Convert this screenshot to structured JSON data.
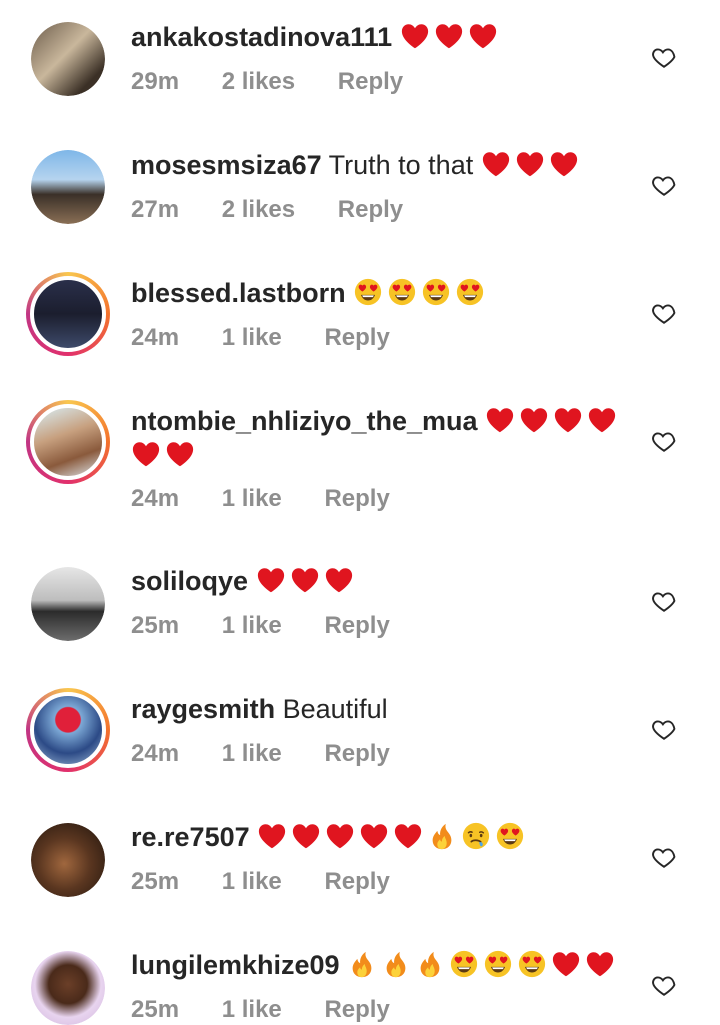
{
  "comments": [
    {
      "username": "ankakostadinova111",
      "text": "",
      "emoji": [
        "heart",
        "heart",
        "heart"
      ],
      "time": "29m",
      "likes": "2 likes",
      "reply": "Reply",
      "story": false
    },
    {
      "username": "mosesmsiza67",
      "text": "Truth to that",
      "emoji": [
        "heart",
        "heart",
        "heart"
      ],
      "time": "27m",
      "likes": "2 likes",
      "reply": "Reply",
      "story": false
    },
    {
      "username": "blessed.lastborn",
      "text": "",
      "emoji": [
        "heart-eyes",
        "heart-eyes",
        "heart-eyes",
        "heart-eyes"
      ],
      "time": "24m",
      "likes": "1 like",
      "reply": "Reply",
      "story": true
    },
    {
      "username": "ntombie_nhliziyo_the_mua",
      "text": "",
      "emoji": [
        "heart",
        "heart",
        "heart",
        "heart",
        "heart",
        "heart"
      ],
      "time": "24m",
      "likes": "1 like",
      "reply": "Reply",
      "story": true
    },
    {
      "username": "soliloqye",
      "text": "",
      "emoji": [
        "heart",
        "heart",
        "heart"
      ],
      "time": "25m",
      "likes": "1 like",
      "reply": "Reply",
      "story": false
    },
    {
      "username": "raygesmith",
      "text": "Beautiful",
      "emoji": [],
      "time": "24m",
      "likes": "1 like",
      "reply": "Reply",
      "story": true
    },
    {
      "username": "re.re7507",
      "text": "",
      "emoji": [
        "heart",
        "heart",
        "heart",
        "heart",
        "heart",
        "fire",
        "drooling",
        "heart-eyes"
      ],
      "time": "25m",
      "likes": "1 like",
      "reply": "Reply",
      "story": false
    },
    {
      "username": "lungilemkhize09",
      "text": "",
      "emoji": [
        "fire",
        "fire",
        "fire",
        "heart-eyes",
        "heart-eyes",
        "heart-eyes",
        "heart",
        "heart"
      ],
      "time": "25m",
      "likes": "1 like",
      "reply": "Reply",
      "story": false
    }
  ],
  "colors": {
    "heart": "#e0151f",
    "meta": "#8e8e8e",
    "text": "#262626"
  }
}
